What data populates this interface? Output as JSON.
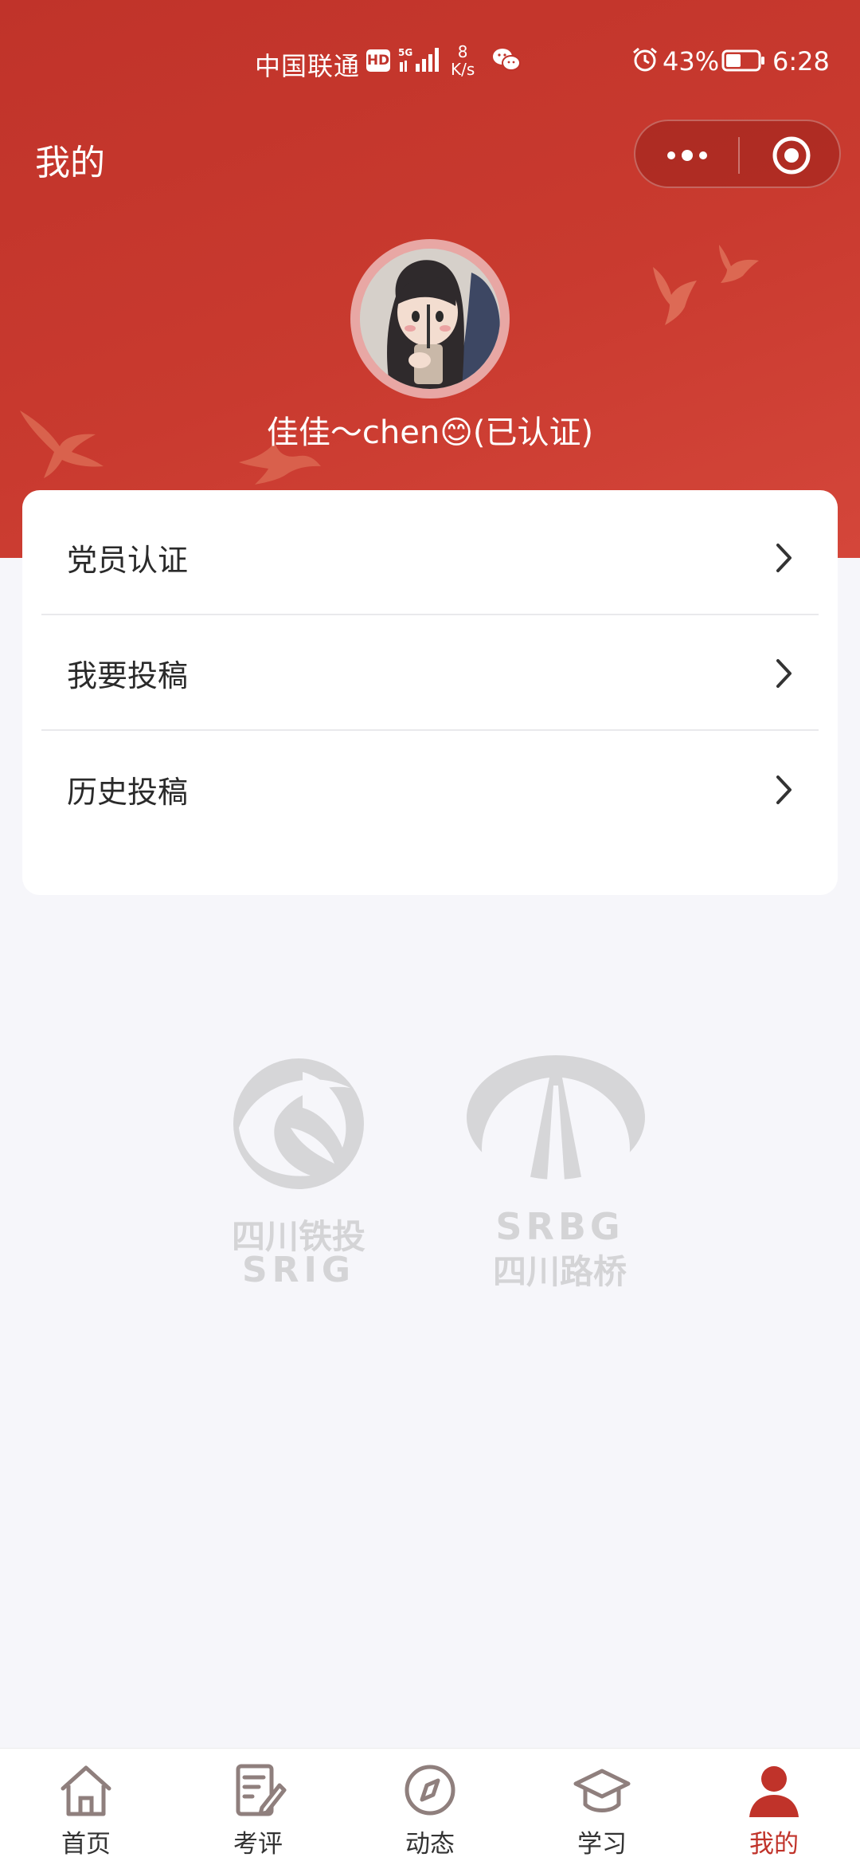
{
  "status_bar": {
    "carrier": "中国联通",
    "hd": "HD",
    "network": "5G",
    "speed_value": "8",
    "speed_unit": "K/s",
    "battery": "43%",
    "time": "6:28"
  },
  "nav": {
    "title": "我的"
  },
  "profile": {
    "name": "佳佳～chen😊(已认证)"
  },
  "menu": {
    "items": [
      {
        "label": "党员认证"
      },
      {
        "label": "我要投稿"
      },
      {
        "label": "历史投稿"
      }
    ]
  },
  "logos": {
    "left_cn": "四川铁投",
    "left_en": "SRIG",
    "right_en": "SRBG",
    "right_cn": "四川路桥"
  },
  "tabs": [
    {
      "label": "首页",
      "icon": "home-icon"
    },
    {
      "label": "考评",
      "icon": "edit-document-icon"
    },
    {
      "label": "动态",
      "icon": "compass-icon"
    },
    {
      "label": "学习",
      "icon": "graduation-cap-icon"
    },
    {
      "label": "我的",
      "icon": "user-icon",
      "active": true
    }
  ],
  "colors": {
    "primary_red": "#c0332a",
    "background": "#f6f6fa",
    "tab_inactive_icon": "#8f7f7d"
  }
}
